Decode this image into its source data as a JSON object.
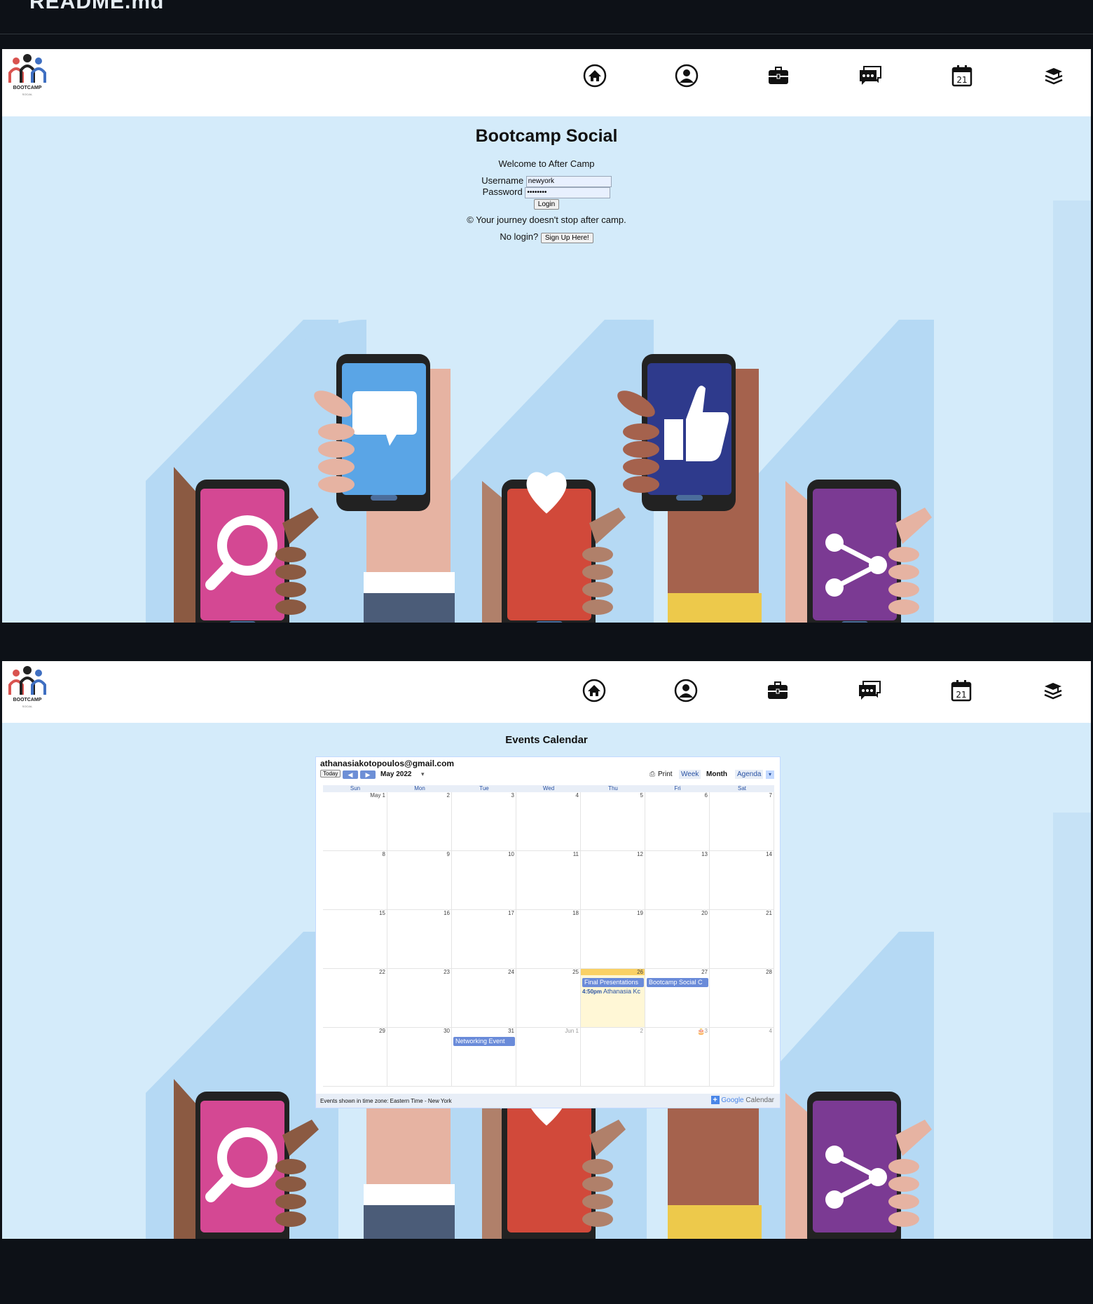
{
  "readme": {
    "title": "README.md"
  },
  "nav": {
    "logo_text": "BOOTCAMP",
    "logo_sub": "SOCIAL",
    "icons": [
      "home-icon",
      "profile-icon",
      "briefcase-icon",
      "messages-icon",
      "calendar-icon",
      "books-icon"
    ]
  },
  "login": {
    "title": "Bootcamp Social",
    "welcome": "Welcome to After Camp",
    "username_label": "Username",
    "username_value": "newyork",
    "password_label": "Password",
    "password_value": "••••••••",
    "login_button": "Login",
    "copyright": "© Your journey doesn't stop after camp.",
    "nologin": "No login?",
    "signup_button": "Sign Up Here!"
  },
  "calendar": {
    "page_title": "Events Calendar",
    "owner": "athanasiakotopoulos@gmail.com",
    "today_button": "Today",
    "month_label": "May 2022",
    "print_label": "Print",
    "view_week": "Week",
    "view_month": "Month",
    "view_agenda": "Agenda",
    "days_of_week": [
      "Sun",
      "Mon",
      "Tue",
      "Wed",
      "Thu",
      "Fri",
      "Sat"
    ],
    "weeks": [
      [
        "May 1",
        "2",
        "3",
        "4",
        "5",
        "6",
        "7"
      ],
      [
        "8",
        "9",
        "10",
        "11",
        "12",
        "13",
        "14"
      ],
      [
        "15",
        "16",
        "17",
        "18",
        "19",
        "20",
        "21"
      ],
      [
        "22",
        "23",
        "24",
        "25",
        "26",
        "27",
        "28"
      ],
      [
        "29",
        "30",
        "31",
        "Jun 1",
        "2",
        "3",
        "4"
      ]
    ],
    "events": [
      {
        "week": 3,
        "day": 4,
        "title": "Final Presentations",
        "style": "bar"
      },
      {
        "week": 3,
        "day": 5,
        "title": "Bootcamp Social C",
        "style": "bar"
      },
      {
        "week": 3,
        "day": 4,
        "time": "4:50pm",
        "title": "Athanasia Kc",
        "style": "text"
      },
      {
        "week": 4,
        "day": 2,
        "title": "Networking Event",
        "style": "bar"
      }
    ],
    "today": {
      "week": 3,
      "day": 4
    },
    "timezone_note": "Events shown in time zone: Eastern Time - New York",
    "google_label_google": "Google",
    "google_label_calendar": "Calendar"
  }
}
